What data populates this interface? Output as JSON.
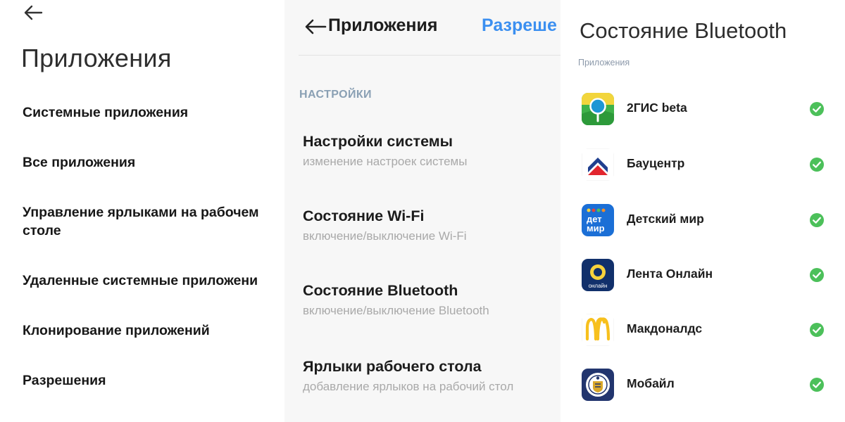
{
  "panel1": {
    "title": "Приложения",
    "items": [
      {
        "label": "Системные приложения"
      },
      {
        "label": "Все приложения"
      },
      {
        "label_line1": "Управление ярлыками на рабочем",
        "label_line2": "столе"
      },
      {
        "label": "Удаленные системные приложени"
      },
      {
        "label": "Клонирование приложений"
      },
      {
        "label": "Разрешения"
      }
    ]
  },
  "panel2": {
    "title": "Приложения",
    "tab_label": "Разреше",
    "section_label": "НАСТРОЙКИ",
    "settings": [
      {
        "title": "Настройки системы",
        "subtitle": "изменение настроек системы"
      },
      {
        "title": "Состояние Wi-Fi",
        "subtitle": "включение/выключение Wi-Fi"
      },
      {
        "title": "Состояние Bluetooth",
        "subtitle": "включение/выключение Bluetooth"
      },
      {
        "title": "Ярлыки рабочего стола",
        "subtitle": "добавление ярлыков на рабочий стол"
      }
    ]
  },
  "panel3": {
    "title": "Состояние Bluetooth",
    "section_label": "Приложения",
    "apps": [
      {
        "name": "2ГИС beta",
        "icon": "2gis-icon",
        "allowed": true
      },
      {
        "name": "Бауцентр",
        "icon": "baucenter-icon",
        "allowed": true
      },
      {
        "name": "Детский мир",
        "icon": "detskiy-mir-icon",
        "icon_text_1": "дет",
        "icon_text_2": "мир",
        "allowed": true
      },
      {
        "name": "Лента Онлайн",
        "icon": "lenta-icon",
        "icon_text": "онлайн",
        "allowed": true
      },
      {
        "name": "Макдоналдс",
        "icon": "mcdonalds-icon",
        "allowed": true
      },
      {
        "name": "Мобайл",
        "icon": "mobile-icon",
        "allowed": true
      }
    ]
  },
  "colors": {
    "accent_blue": "#3b8ff0",
    "check_green": "#4cc05a",
    "section_gray": "#8aa0b4",
    "subtitle_gray": "#a9a9a9"
  }
}
